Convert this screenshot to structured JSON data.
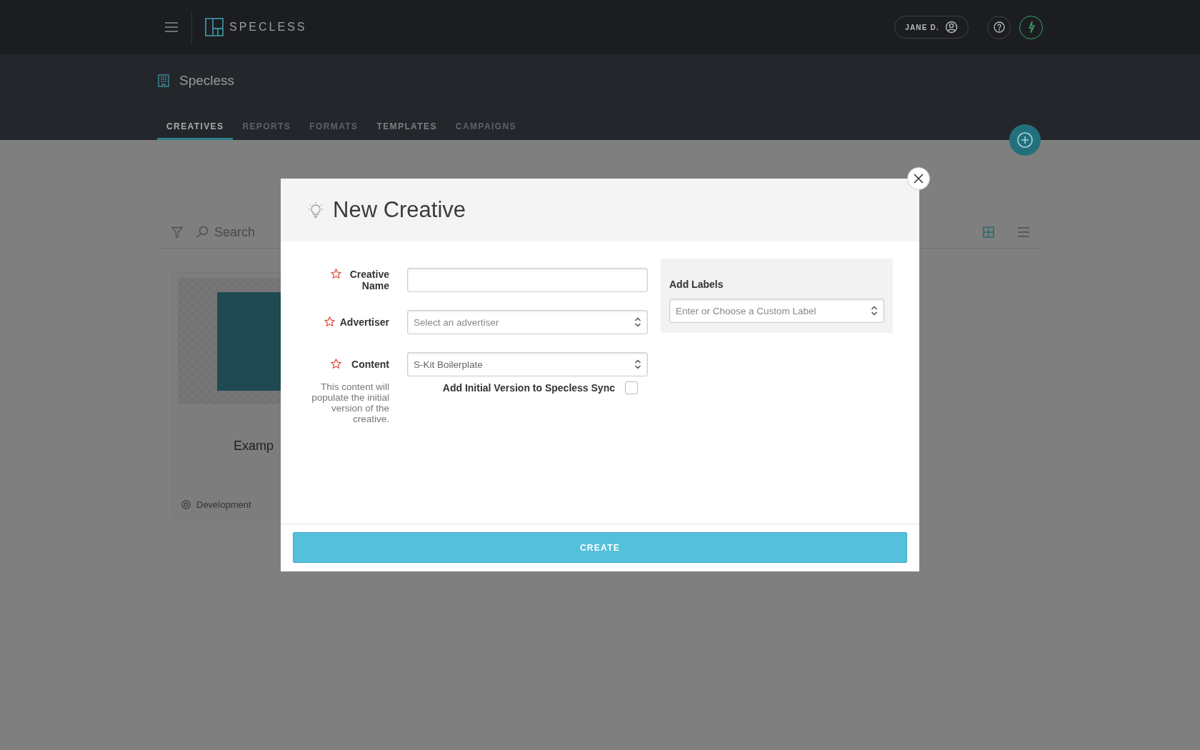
{
  "app_bar": {
    "brand": "SPECLESS",
    "user": "JANE D."
  },
  "workspace": {
    "title": "Specless"
  },
  "tabs": [
    {
      "label": "CREATIVES",
      "selected": true,
      "disabled": false
    },
    {
      "label": "REPORTS",
      "selected": false,
      "disabled": true
    },
    {
      "label": "FORMATS",
      "selected": false,
      "disabled": true
    },
    {
      "label": "TEMPLATES",
      "selected": false,
      "disabled": false
    },
    {
      "label": "CAMPAIGNS",
      "selected": false,
      "disabled": true
    }
  ],
  "toolbar": {
    "search_placeholder": "Search",
    "views": [
      {
        "kind": "grid",
        "selected": true
      },
      {
        "kind": "list",
        "selected": false
      }
    ]
  },
  "cards": [
    {
      "title": "Examp",
      "status": "Development"
    }
  ],
  "dialog": {
    "title": "New Creative",
    "fields": [
      {
        "label": "Creative Name",
        "required": true,
        "kind": "text"
      },
      {
        "label": "Advertiser",
        "required": true,
        "kind": "select",
        "placeholder": "Select an advertiser"
      },
      {
        "label": "Content",
        "required": true,
        "kind": "select",
        "value": "S-Kit Boilerplate"
      }
    ],
    "help_text": "This content will populate the initial version of the creative.",
    "sync_option": {
      "label": "Add Initial Version to Specless Sync",
      "checked": false
    },
    "labels_panel": {
      "title": "Add Labels",
      "placeholder": "Enter or Choose a Custom Label"
    },
    "submit": "CREATE"
  }
}
